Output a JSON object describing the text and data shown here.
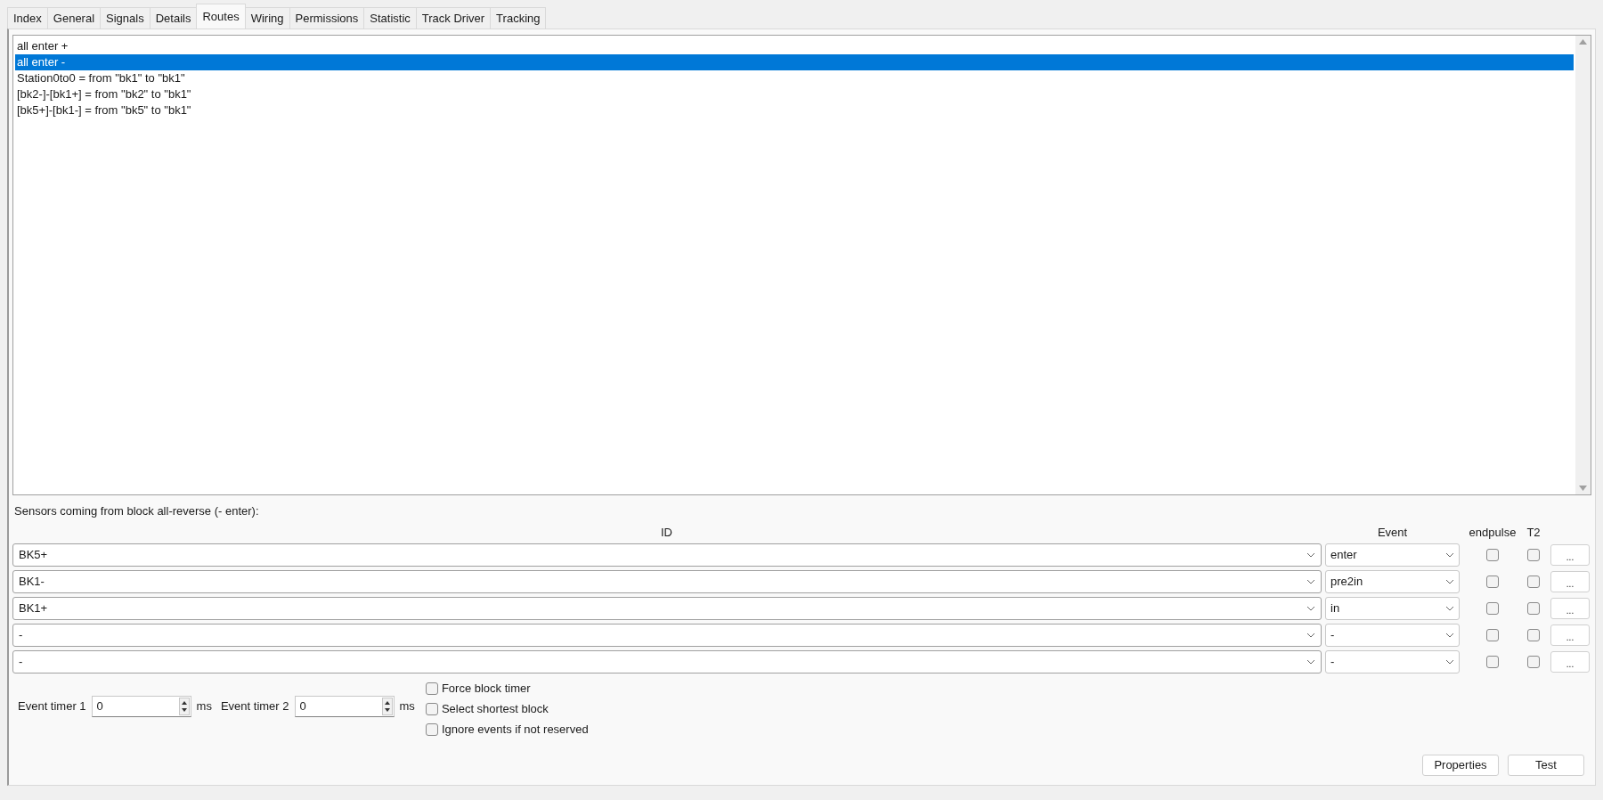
{
  "tabs": [
    {
      "label": "Index",
      "selected": false
    },
    {
      "label": "General",
      "selected": false
    },
    {
      "label": "Signals",
      "selected": false
    },
    {
      "label": "Details",
      "selected": false
    },
    {
      "label": "Routes",
      "selected": true
    },
    {
      "label": "Wiring",
      "selected": false
    },
    {
      "label": "Permissions",
      "selected": false
    },
    {
      "label": "Statistic",
      "selected": false
    },
    {
      "label": "Track Driver",
      "selected": false
    },
    {
      "label": "Tracking",
      "selected": false
    }
  ],
  "routes_list": {
    "items": [
      {
        "label": "all enter +",
        "selected": false
      },
      {
        "label": "all enter -",
        "selected": true
      },
      {
        "label": "Station0to0 = from \"bk1\" to \"bk1\"",
        "selected": false
      },
      {
        "label": "[bk2-]-[bk1+] = from \"bk2\" to \"bk1\"",
        "selected": false
      },
      {
        "label": "[bk5+]-[bk1-] = from \"bk5\" to \"bk1\"",
        "selected": false
      }
    ]
  },
  "sensors": {
    "title": "Sensors coming from block all-reverse (- enter):",
    "columns": [
      "ID",
      "Event",
      "endpulse",
      "T2"
    ],
    "rows": [
      {
        "id": "BK5+",
        "event": "enter",
        "endpulse": false,
        "t2": false,
        "button": "..."
      },
      {
        "id": "BK1-",
        "event": "pre2in",
        "endpulse": false,
        "t2": false,
        "button": "..."
      },
      {
        "id": "BK1+",
        "event": "in",
        "endpulse": false,
        "t2": false,
        "button": "..."
      },
      {
        "id": "-",
        "event": "-",
        "endpulse": false,
        "t2": false,
        "button": "..."
      },
      {
        "id": "-",
        "event": "-",
        "endpulse": false,
        "t2": false,
        "button": "..."
      }
    ]
  },
  "timers": [
    {
      "label": "Event timer 1",
      "value": "0",
      "unit": "ms"
    },
    {
      "label": "Event timer 2",
      "value": "0",
      "unit": "ms"
    }
  ],
  "options": [
    {
      "label": "Force block timer",
      "checked": false
    },
    {
      "label": "Select shortest block",
      "checked": false
    },
    {
      "label": "Ignore events if not reserved",
      "checked": false
    }
  ],
  "buttons": [
    "Properties",
    "Test"
  ]
}
